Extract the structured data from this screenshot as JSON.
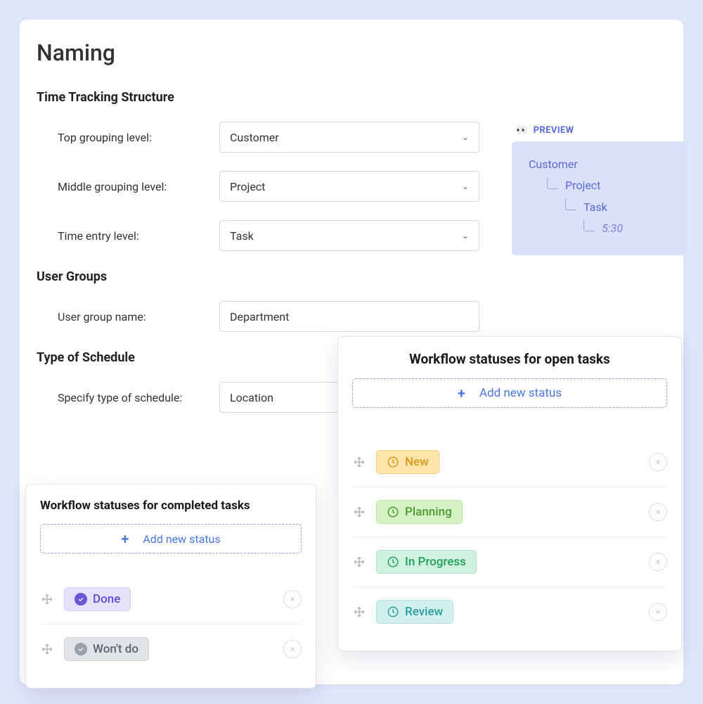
{
  "page_title": "Naming",
  "sections": {
    "structure": {
      "title": "Time Tracking Structure",
      "rows": {
        "top": {
          "label": "Top grouping level:",
          "value": "Customer"
        },
        "middle": {
          "label": "Middle grouping level:",
          "value": "Project"
        },
        "entry": {
          "label": "Time entry level:",
          "value": "Task"
        }
      }
    },
    "user_groups": {
      "title": "User Groups",
      "name_label": "User group name:",
      "name_value": "Department"
    },
    "schedule": {
      "title": "Type of Schedule",
      "label": "Specify type of schedule:",
      "value": "Location"
    }
  },
  "preview": {
    "label": "PREVIEW",
    "eyes": "👀",
    "levels": [
      "Customer",
      "Project",
      "Task"
    ],
    "time": "5:30"
  },
  "workflow_open": {
    "title": "Workflow statuses for open tasks",
    "add_label": "Add new status",
    "statuses": [
      {
        "name": "New",
        "color": "yellow"
      },
      {
        "name": "Planning",
        "color": "green"
      },
      {
        "name": "In Progress",
        "color": "emerald"
      },
      {
        "name": "Review",
        "color": "teal"
      }
    ]
  },
  "workflow_completed": {
    "title": "Workflow statuses for completed tasks",
    "add_label": "Add new status",
    "statuses": [
      {
        "name": "Done",
        "color": "purple"
      },
      {
        "name": "Won't do",
        "color": "gray"
      }
    ]
  }
}
